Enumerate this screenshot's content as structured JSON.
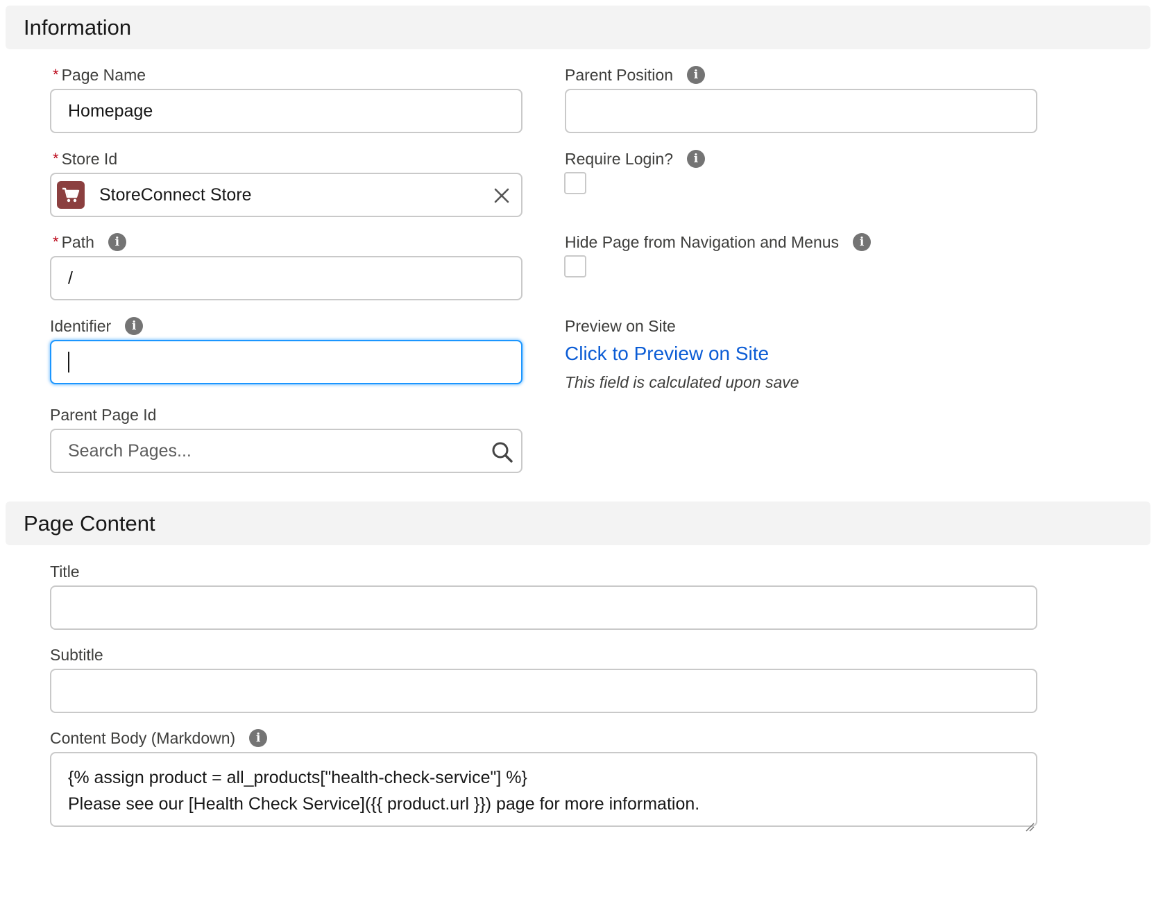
{
  "sections": {
    "information": {
      "title": "Information"
    },
    "page_content": {
      "title": "Page Content"
    }
  },
  "fields": {
    "page_name": {
      "label": "Page Name",
      "required": "*",
      "value": "Homepage"
    },
    "store_id": {
      "label": "Store Id",
      "required": "*",
      "value": "StoreConnect Store",
      "icon": "cart-icon"
    },
    "path": {
      "label": "Path",
      "required": "*",
      "value": "/"
    },
    "identifier": {
      "label": "Identifier",
      "value": ""
    },
    "parent_page_id": {
      "label": "Parent Page Id",
      "placeholder": "Search Pages..."
    },
    "parent_position": {
      "label": "Parent Position",
      "value": ""
    },
    "require_login": {
      "label": "Require Login?",
      "checked": false
    },
    "hide_page": {
      "label": "Hide Page from Navigation and Menus",
      "checked": false
    },
    "preview": {
      "label": "Preview on Site",
      "link_text": "Click to Preview on Site",
      "help": "This field is calculated upon save"
    },
    "title": {
      "label": "Title",
      "value": ""
    },
    "subtitle": {
      "label": "Subtitle",
      "value": ""
    },
    "content_body": {
      "label": "Content Body (Markdown)",
      "lines": [
        "{% assign product = all_products[\"health-check-service\"] %}",
        "Please see our [Health Check Service]({{ product.url }}) page for more information."
      ]
    }
  },
  "info_icon_glyph": "i",
  "colors": {
    "required": "#ba0517",
    "link": "#0b5cd5",
    "focus": "#1b96ff",
    "store_icon_bg": "#8b3f3f"
  }
}
